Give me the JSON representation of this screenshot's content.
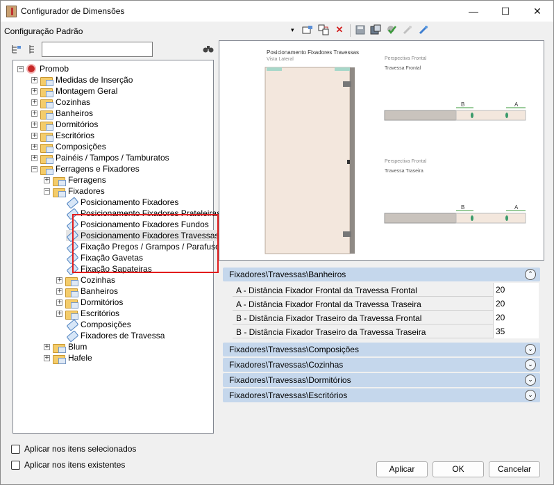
{
  "window": {
    "title": "Configurador de Dimensões",
    "min": "—",
    "max": "☐",
    "close": "✕"
  },
  "toolbar": {
    "config_label": "Configuração Padrão",
    "dropdown": "▾"
  },
  "tree": {
    "root": "Promob",
    "items": [
      "Medidas de Inserção",
      "Montagem Geral",
      "Cozinhas",
      "Banheiros",
      "Dormitórios",
      "Escritórios",
      "Composições",
      "Painéis / Tampos / Tamburatos",
      "Ferragens e Fixadores",
      "Ferragens",
      "Fixadores",
      "Posicionamento Fixadores",
      "Posicionamento Fixadores Prateleiras",
      "Posicionamento Fixadores Fundos",
      "Posicionamento Fixadores Travessas",
      "Fixação Pregos / Grampos / Parafusos",
      "Fixação Gavetas",
      "Fixação Sapateiras",
      "Cozinhas",
      "Banheiros",
      "Dormitórios",
      "Escritórios",
      "Composições",
      "Fixadores de Travessa",
      "Blum",
      "Hafele"
    ]
  },
  "preview": {
    "title": "Posicionamento Fixadores Travessas",
    "subtitle": "Vista Lateral",
    "front_persp": "Perspectiva Frontal",
    "front_label": "Travessa Frontal",
    "back_persp": "Perspectiva Frontal",
    "back_label": "Travessa Traseira",
    "dim_b": "B",
    "dim_a": "A"
  },
  "groups": {
    "g1": "Fixadores\\Travessas\\Banheiros",
    "g2": "Fixadores\\Travessas\\Composições",
    "g3": "Fixadores\\Travessas\\Cozinhas",
    "g4": "Fixadores\\Travessas\\Dormitórios",
    "g5": "Fixadores\\Travessas\\Escritórios"
  },
  "props": [
    {
      "k": "A - Distância Fixador Frontal da Travessa Frontal",
      "v": "20"
    },
    {
      "k": "A - Distância Fixador Frontal da Travessa Traseira",
      "v": "20"
    },
    {
      "k": "B - Distância Fixador Traseiro da Travessa Frontal",
      "v": "20"
    },
    {
      "k": "B - Distância Fixador Traseiro da Travessa Traseira",
      "v": "35"
    }
  ],
  "options": {
    "selected": "Aplicar nos itens selecionados",
    "existing": "Aplicar nos itens existentes"
  },
  "buttons": {
    "apply": "Aplicar",
    "ok": "OK",
    "cancel": "Cancelar"
  }
}
